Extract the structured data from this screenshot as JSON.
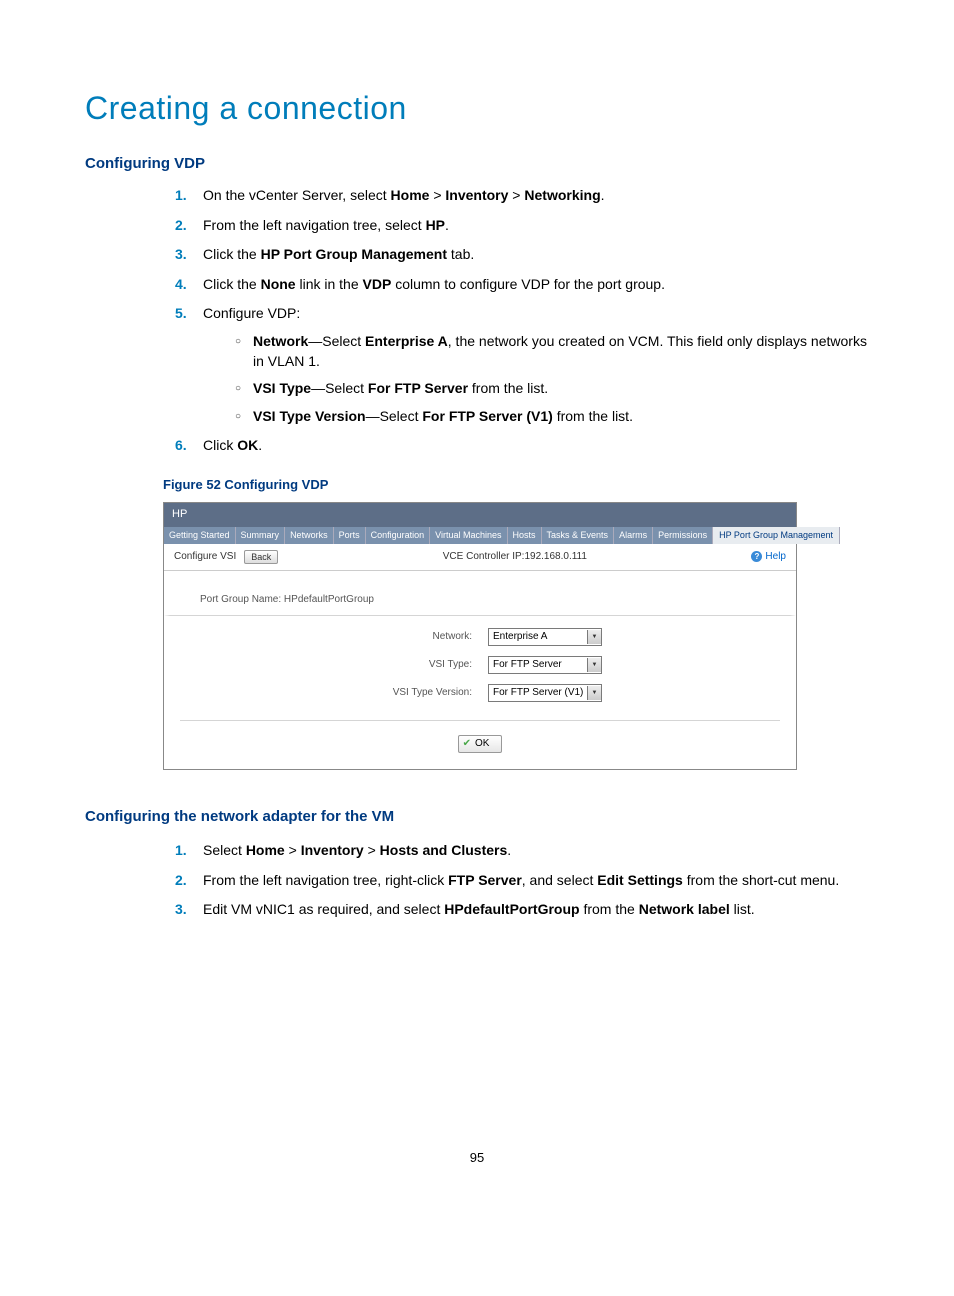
{
  "page_number": "95",
  "h1": "Creating a connection",
  "section1": {
    "title": "Configuring VDP",
    "steps": {
      "s1_pre": "On the vCenter Server, select ",
      "s1_b1": "Home",
      "s1_m1": " > ",
      "s1_b2": "Inventory",
      "s1_m2": " > ",
      "s1_b3": "Networking",
      "s1_post": ".",
      "s2_pre": "From the left navigation tree, select ",
      "s2_b": "HP",
      "s2_post": ".",
      "s3_pre": "Click the ",
      "s3_b": "HP Port Group Management",
      "s3_post": " tab.",
      "s4_pre": "Click the ",
      "s4_b1": "None",
      "s4_m": " link in the ",
      "s4_b2": "VDP",
      "s4_post": " column to configure VDP for the port group.",
      "s5": "Configure VDP:",
      "s5a_b": "Network",
      "s5a_m1": "—Select ",
      "s5a_b2": "Enterprise A",
      "s5a_post": ", the network you created on VCM. This field only displays networks in VLAN 1.",
      "s5b_b": "VSI Type",
      "s5b_m1": "—Select ",
      "s5b_b2": "For FTP Server",
      "s5b_post": " from the list.",
      "s5c_b": "VSI Type Version",
      "s5c_m1": "—Select ",
      "s5c_b2": "For FTP Server (V1)",
      "s5c_post": " from the list.",
      "s6_pre": "Click ",
      "s6_b": "OK",
      "s6_post": "."
    },
    "figure_caption": "Figure 52 Configuring VDP"
  },
  "screenshot": {
    "window_title": "HP",
    "tabs": [
      "Getting Started",
      "Summary",
      "Networks",
      "Ports",
      "Configuration",
      "Virtual Machines",
      "Hosts",
      "Tasks & Events",
      "Alarms",
      "Permissions"
    ],
    "active_tab": "HP Port Group Management",
    "toolbar": {
      "configure_label": "Configure VSI",
      "back_label": "Back",
      "center": "VCE Controller IP:192.168.0.111",
      "help_label": "Help"
    },
    "port_group_label": "Port Group Name: HPdefaultPortGroup",
    "form": {
      "network_label": "Network:",
      "network_value": "Enterprise A",
      "vsi_type_label": "VSI Type:",
      "vsi_type_value": "For FTP Server",
      "vsi_ver_label": "VSI Type Version:",
      "vsi_ver_value": "For FTP Server (V1)"
    },
    "ok_label": "OK"
  },
  "section2": {
    "title": "Configuring the network adapter for the VM",
    "s1_pre": "Select ",
    "s1_b1": "Home",
    "s1_m1": " > ",
    "s1_b2": "Inventory",
    "s1_m2": " > ",
    "s1_b3": "Hosts and Clusters",
    "s1_post": ".",
    "s2_pre": "From the left navigation tree, right-click ",
    "s2_b1": "FTP Server",
    "s2_m": ", and select ",
    "s2_b2": "Edit Settings",
    "s2_post": " from the short-cut menu.",
    "s3_pre": "Edit VM vNIC1 as required, and select ",
    "s3_b1": "HPdefaultPortGroup",
    "s3_m": " from the ",
    "s3_b2": "Network label",
    "s3_post": " list."
  }
}
